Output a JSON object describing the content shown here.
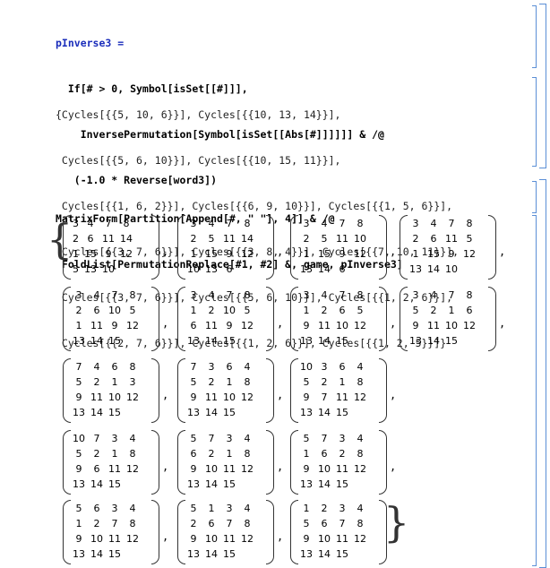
{
  "input1": {
    "lines": [
      "pInverse3 =",
      "  If[# > 0, Symbol[isSet[[#]]],",
      "    InversePermutation[Symbol[isSet[[Abs[#]]]]]] & /@",
      "   (-1.0 * Reverse[word3])"
    ]
  },
  "output1": {
    "lines": [
      "{Cycles[{{5, 10, 6}}], Cycles[{{10, 13, 14}}],",
      " Cycles[{{5, 6, 10}}], Cycles[{{10, 15, 11}}],",
      " Cycles[{{1, 6, 2}}], Cycles[{{6, 9, 10}}], Cycles[{{1, 5, 6}}],",
      " Cycles[{{3, 7, 6}}], Cycles[{{3, 8, 4}}], Cycles[{{7, 10, 11}}],",
      " Cycles[{{3, 7, 6}}], Cycles[{{5, 6, 10}}], Cycles[{{1, 2, 6}}],",
      " Cycles[{{2, 7, 6}}], Cycles[{{1, 2, 6}}], Cycles[{{1, 2, 5}}]}"
    ]
  },
  "input2": {
    "lines": [
      "MatrixForm[Partition[Append[#, \" \"], 4]] & /@",
      " FoldList[PermutationReplace[#1, #2] &, game, pInverse3]"
    ]
  },
  "matrices": [
    [
      [
        "3",
        "4",
        "7",
        "8"
      ],
      [
        "2",
        "6",
        "11",
        "14"
      ],
      [
        "1",
        "15",
        "9",
        "12"
      ],
      [
        "5",
        "13",
        "10",
        ""
      ]
    ],
    [
      [
        "3",
        "4",
        "7",
        "8"
      ],
      [
        "2",
        "5",
        "11",
        "14"
      ],
      [
        "1",
        "15",
        "9",
        "12"
      ],
      [
        "10",
        "13",
        "6",
        ""
      ]
    ],
    [
      [
        "3",
        "4",
        "7",
        "8"
      ],
      [
        "2",
        "5",
        "11",
        "10"
      ],
      [
        "1",
        "15",
        "9",
        "12"
      ],
      [
        "13",
        "14",
        "6",
        ""
      ]
    ],
    [
      [
        "3",
        "4",
        "7",
        "8"
      ],
      [
        "2",
        "6",
        "11",
        "5"
      ],
      [
        "1",
        "15",
        "9",
        "12"
      ],
      [
        "13",
        "14",
        "10",
        ""
      ]
    ],
    [
      [
        "3",
        "4",
        "7",
        "8"
      ],
      [
        "2",
        "6",
        "10",
        "5"
      ],
      [
        "1",
        "11",
        "9",
        "12"
      ],
      [
        "13",
        "14",
        "15",
        ""
      ]
    ],
    [
      [
        "3",
        "4",
        "7",
        "8"
      ],
      [
        "1",
        "2",
        "10",
        "5"
      ],
      [
        "6",
        "11",
        "9",
        "12"
      ],
      [
        "13",
        "14",
        "15",
        ""
      ]
    ],
    [
      [
        "3",
        "4",
        "7",
        "8"
      ],
      [
        "1",
        "2",
        "6",
        "5"
      ],
      [
        "9",
        "11",
        "10",
        "12"
      ],
      [
        "13",
        "14",
        "15",
        ""
      ]
    ],
    [
      [
        "3",
        "4",
        "7",
        "8"
      ],
      [
        "5",
        "2",
        "1",
        "6"
      ],
      [
        "9",
        "11",
        "10",
        "12"
      ],
      [
        "13",
        "14",
        "15",
        ""
      ]
    ],
    [
      [
        "7",
        "4",
        "6",
        "8"
      ],
      [
        "5",
        "2",
        "1",
        "3"
      ],
      [
        "9",
        "11",
        "10",
        "12"
      ],
      [
        "13",
        "14",
        "15",
        ""
      ]
    ],
    [
      [
        "7",
        "3",
        "6",
        "4"
      ],
      [
        "5",
        "2",
        "1",
        "8"
      ],
      [
        "9",
        "11",
        "10",
        "12"
      ],
      [
        "13",
        "14",
        "15",
        ""
      ]
    ],
    [
      [
        "10",
        "3",
        "6",
        "4"
      ],
      [
        "5",
        "2",
        "1",
        "8"
      ],
      [
        "9",
        "7",
        "11",
        "12"
      ],
      [
        "13",
        "14",
        "15",
        ""
      ]
    ],
    [
      [
        "10",
        "7",
        "3",
        "4"
      ],
      [
        "5",
        "2",
        "1",
        "8"
      ],
      [
        "9",
        "6",
        "11",
        "12"
      ],
      [
        "13",
        "14",
        "15",
        ""
      ]
    ],
    [
      [
        "5",
        "7",
        "3",
        "4"
      ],
      [
        "6",
        "2",
        "1",
        "8"
      ],
      [
        "9",
        "10",
        "11",
        "12"
      ],
      [
        "13",
        "14",
        "15",
        ""
      ]
    ],
    [
      [
        "5",
        "7",
        "3",
        "4"
      ],
      [
        "1",
        "6",
        "2",
        "8"
      ],
      [
        "9",
        "10",
        "11",
        "12"
      ],
      [
        "13",
        "14",
        "15",
        ""
      ]
    ],
    [
      [
        "5",
        "6",
        "3",
        "4"
      ],
      [
        "1",
        "2",
        "7",
        "8"
      ],
      [
        "9",
        "10",
        "11",
        "12"
      ],
      [
        "13",
        "14",
        "15",
        ""
      ]
    ],
    [
      [
        "5",
        "1",
        "3",
        "4"
      ],
      [
        "2",
        "6",
        "7",
        "8"
      ],
      [
        "9",
        "10",
        "11",
        "12"
      ],
      [
        "13",
        "14",
        "15",
        ""
      ]
    ],
    [
      [
        "1",
        "2",
        "3",
        "4"
      ],
      [
        "5",
        "6",
        "7",
        "8"
      ],
      [
        "9",
        "10",
        "11",
        "12"
      ],
      [
        "13",
        "14",
        "15",
        ""
      ]
    ]
  ],
  "colors": {
    "bracket": "#5b8fd6",
    "keyword": "#1a2dbb",
    "slot": "#3a7f2e"
  }
}
